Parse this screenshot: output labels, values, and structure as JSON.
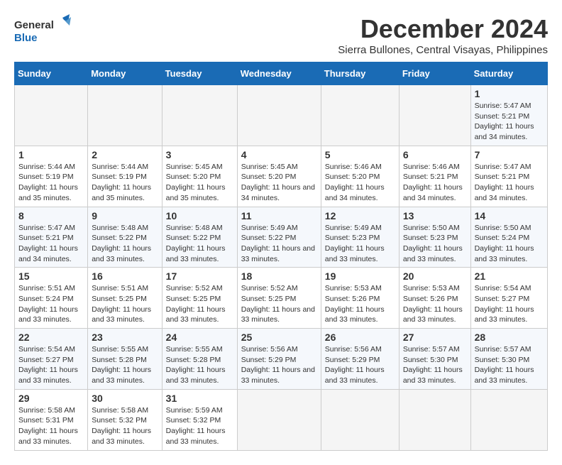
{
  "header": {
    "logo_text_general": "General",
    "logo_text_blue": "Blue",
    "main_title": "December 2024",
    "subtitle": "Sierra Bullones, Central Visayas, Philippines"
  },
  "calendar": {
    "month": "December 2024",
    "location": "Sierra Bullones, Central Visayas, Philippines",
    "days_of_week": [
      "Sunday",
      "Monday",
      "Tuesday",
      "Wednesday",
      "Thursday",
      "Friday",
      "Saturday"
    ],
    "weeks": [
      [
        null,
        null,
        null,
        null,
        null,
        null,
        {
          "day": 1,
          "sunrise": "5:47 AM",
          "sunset": "5:21 PM",
          "daylight": "11 hours and 34 minutes."
        }
      ],
      [
        {
          "day": 1,
          "sunrise": "5:44 AM",
          "sunset": "5:19 PM",
          "daylight": "11 hours and 35 minutes."
        },
        {
          "day": 2,
          "sunrise": "5:44 AM",
          "sunset": "5:19 PM",
          "daylight": "11 hours and 35 minutes."
        },
        {
          "day": 3,
          "sunrise": "5:45 AM",
          "sunset": "5:20 PM",
          "daylight": "11 hours and 35 minutes."
        },
        {
          "day": 4,
          "sunrise": "5:45 AM",
          "sunset": "5:20 PM",
          "daylight": "11 hours and 34 minutes."
        },
        {
          "day": 5,
          "sunrise": "5:46 AM",
          "sunset": "5:20 PM",
          "daylight": "11 hours and 34 minutes."
        },
        {
          "day": 6,
          "sunrise": "5:46 AM",
          "sunset": "5:21 PM",
          "daylight": "11 hours and 34 minutes."
        },
        {
          "day": 7,
          "sunrise": "5:47 AM",
          "sunset": "5:21 PM",
          "daylight": "11 hours and 34 minutes."
        }
      ],
      [
        {
          "day": 8,
          "sunrise": "5:47 AM",
          "sunset": "5:21 PM",
          "daylight": "11 hours and 34 minutes."
        },
        {
          "day": 9,
          "sunrise": "5:48 AM",
          "sunset": "5:22 PM",
          "daylight": "11 hours and 33 minutes."
        },
        {
          "day": 10,
          "sunrise": "5:48 AM",
          "sunset": "5:22 PM",
          "daylight": "11 hours and 33 minutes."
        },
        {
          "day": 11,
          "sunrise": "5:49 AM",
          "sunset": "5:22 PM",
          "daylight": "11 hours and 33 minutes."
        },
        {
          "day": 12,
          "sunrise": "5:49 AM",
          "sunset": "5:23 PM",
          "daylight": "11 hours and 33 minutes."
        },
        {
          "day": 13,
          "sunrise": "5:50 AM",
          "sunset": "5:23 PM",
          "daylight": "11 hours and 33 minutes."
        },
        {
          "day": 14,
          "sunrise": "5:50 AM",
          "sunset": "5:24 PM",
          "daylight": "11 hours and 33 minutes."
        }
      ],
      [
        {
          "day": 15,
          "sunrise": "5:51 AM",
          "sunset": "5:24 PM",
          "daylight": "11 hours and 33 minutes."
        },
        {
          "day": 16,
          "sunrise": "5:51 AM",
          "sunset": "5:25 PM",
          "daylight": "11 hours and 33 minutes."
        },
        {
          "day": 17,
          "sunrise": "5:52 AM",
          "sunset": "5:25 PM",
          "daylight": "11 hours and 33 minutes."
        },
        {
          "day": 18,
          "sunrise": "5:52 AM",
          "sunset": "5:25 PM",
          "daylight": "11 hours and 33 minutes."
        },
        {
          "day": 19,
          "sunrise": "5:53 AM",
          "sunset": "5:26 PM",
          "daylight": "11 hours and 33 minutes."
        },
        {
          "day": 20,
          "sunrise": "5:53 AM",
          "sunset": "5:26 PM",
          "daylight": "11 hours and 33 minutes."
        },
        {
          "day": 21,
          "sunrise": "5:54 AM",
          "sunset": "5:27 PM",
          "daylight": "11 hours and 33 minutes."
        }
      ],
      [
        {
          "day": 22,
          "sunrise": "5:54 AM",
          "sunset": "5:27 PM",
          "daylight": "11 hours and 33 minutes."
        },
        {
          "day": 23,
          "sunrise": "5:55 AM",
          "sunset": "5:28 PM",
          "daylight": "11 hours and 33 minutes."
        },
        {
          "day": 24,
          "sunrise": "5:55 AM",
          "sunset": "5:28 PM",
          "daylight": "11 hours and 33 minutes."
        },
        {
          "day": 25,
          "sunrise": "5:56 AM",
          "sunset": "5:29 PM",
          "daylight": "11 hours and 33 minutes."
        },
        {
          "day": 26,
          "sunrise": "5:56 AM",
          "sunset": "5:29 PM",
          "daylight": "11 hours and 33 minutes."
        },
        {
          "day": 27,
          "sunrise": "5:57 AM",
          "sunset": "5:30 PM",
          "daylight": "11 hours and 33 minutes."
        },
        {
          "day": 28,
          "sunrise": "5:57 AM",
          "sunset": "5:30 PM",
          "daylight": "11 hours and 33 minutes."
        }
      ],
      [
        {
          "day": 29,
          "sunrise": "5:58 AM",
          "sunset": "5:31 PM",
          "daylight": "11 hours and 33 minutes."
        },
        {
          "day": 30,
          "sunrise": "5:58 AM",
          "sunset": "5:32 PM",
          "daylight": "11 hours and 33 minutes."
        },
        {
          "day": 31,
          "sunrise": "5:59 AM",
          "sunset": "5:32 PM",
          "daylight": "11 hours and 33 minutes."
        },
        null,
        null,
        null,
        null
      ]
    ]
  }
}
